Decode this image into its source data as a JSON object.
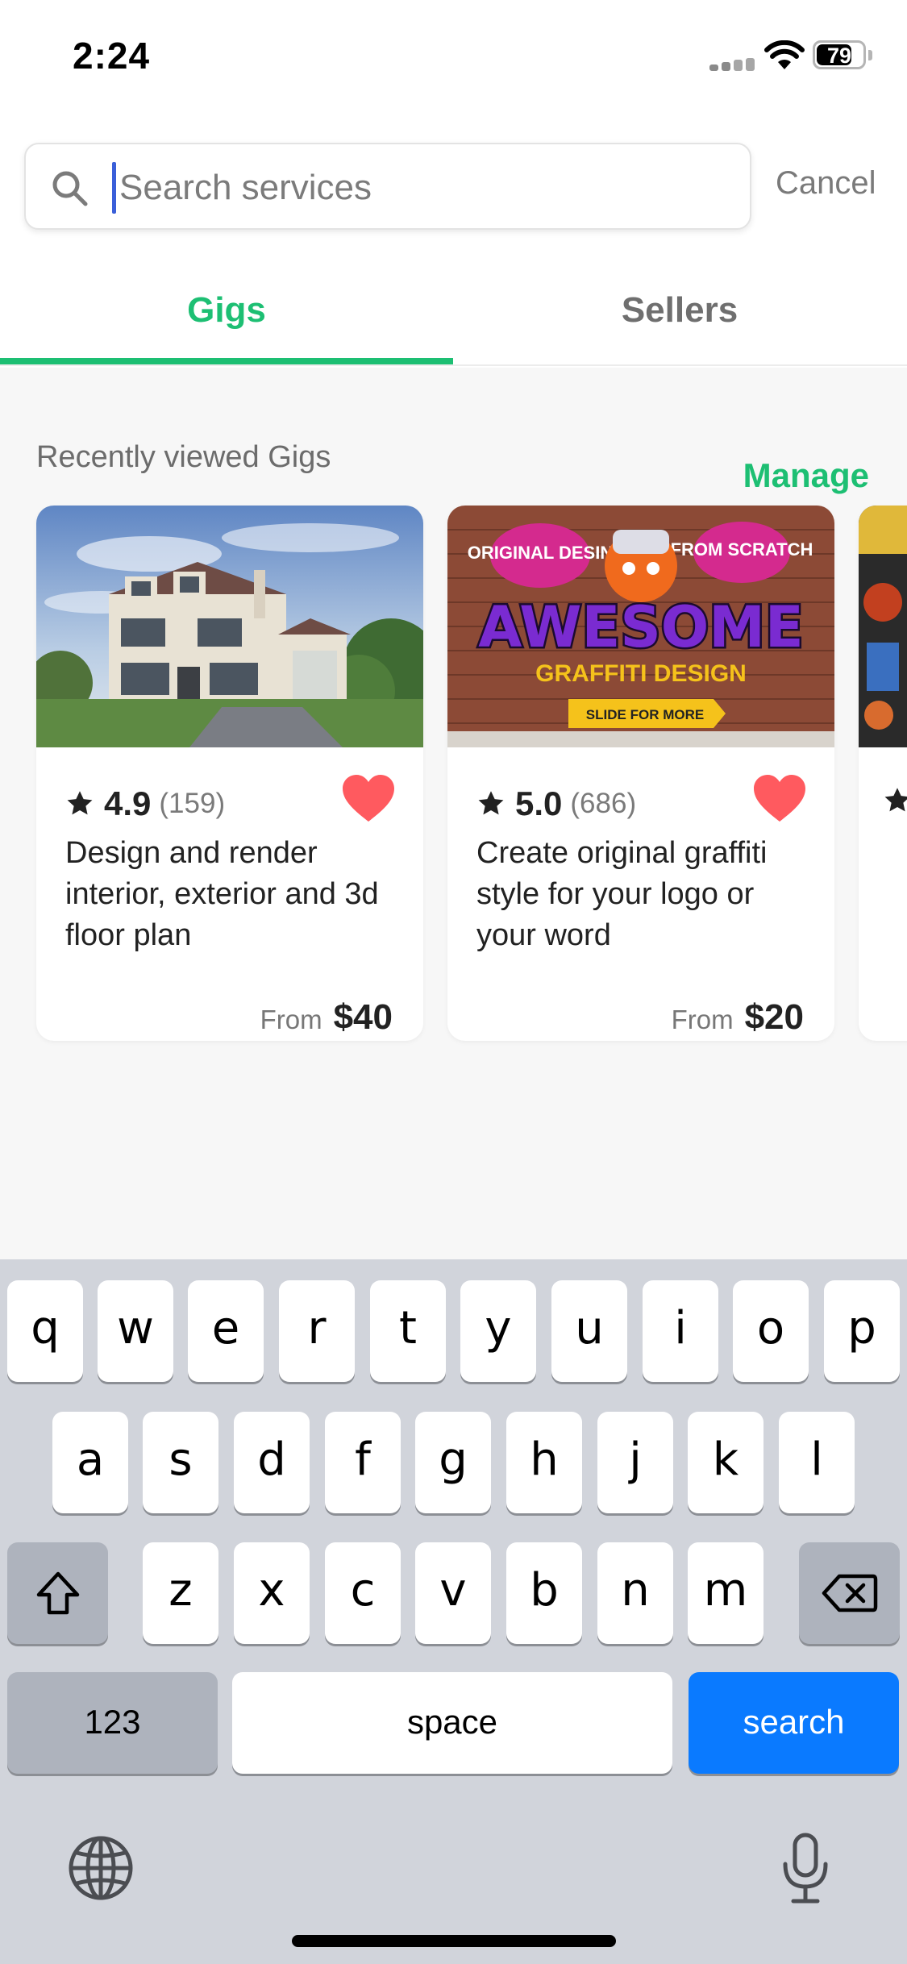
{
  "status_bar": {
    "time": "2:24",
    "battery": "79",
    "battery_level": 0.79
  },
  "search": {
    "placeholder": "Search services",
    "value": "",
    "cancel_label": "Cancel"
  },
  "tabs": [
    {
      "label": "Gigs",
      "active": true
    },
    {
      "label": "Sellers",
      "active": false
    }
  ],
  "recent": {
    "title": "Recently viewed Gigs",
    "manage_label": "Manage",
    "gigs": [
      {
        "rating": "4.9",
        "reviews": "(159)",
        "title": "Design and render interior, exterior and 3d floor plan",
        "from_label": "From",
        "price": "$40",
        "favorited": true,
        "image": "house-render-image"
      },
      {
        "rating": "5.0",
        "reviews": "(686)",
        "title": "Create original graffiti style for your logo or your word",
        "from_label": "From",
        "price": "$20",
        "favorited": true,
        "image": "graffiti-design-image",
        "image_texts": [
          "ORIGINAL DESIN",
          "FROM SCRATCH",
          "AWESOME",
          "GRAFFITI DESIGN",
          "SLIDE FOR MORE"
        ]
      },
      {
        "rating": "",
        "reviews": "",
        "title": "",
        "partially_visible": true,
        "image": "comic-art-image"
      }
    ]
  },
  "keyboard": {
    "row1": [
      "q",
      "w",
      "e",
      "r",
      "t",
      "y",
      "u",
      "i",
      "o",
      "p"
    ],
    "row2": [
      "a",
      "s",
      "d",
      "f",
      "g",
      "h",
      "j",
      "k",
      "l"
    ],
    "row3": [
      "z",
      "x",
      "c",
      "v",
      "b",
      "n",
      "m"
    ],
    "numbers_label": "123",
    "space_label": "space",
    "action_label": "search",
    "icons": [
      "shift-icon",
      "backspace-icon",
      "globe-icon",
      "microphone-icon"
    ]
  },
  "colors": {
    "accent": "#1dbf73",
    "heart": "#ff5a5f",
    "keyboard_action": "#0a7aff",
    "cursor": "#3a5fd9"
  }
}
